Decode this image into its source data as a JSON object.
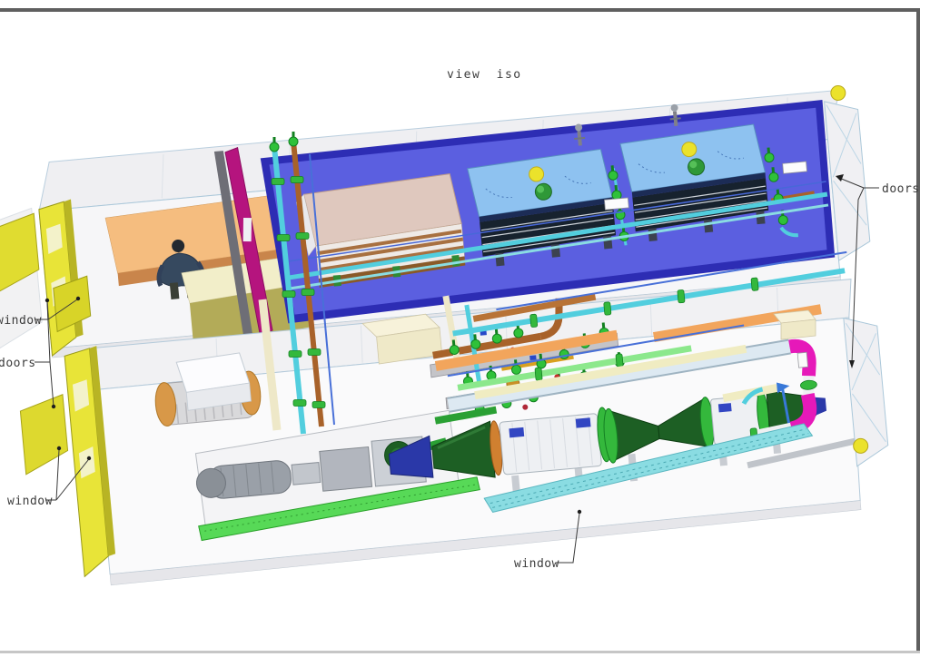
{
  "title": "view iso",
  "annotations": {
    "doors_right": "doors",
    "window_left_upper": "window",
    "doors_left": "doors",
    "window_left_lower": "window",
    "window_bottom": "window"
  },
  "colors": {
    "frame": "#5f5f5f",
    "frame_bottom": "#c6c6c6",
    "shell": "#efeff2",
    "shell_edge": "#a9c6d8",
    "floor_blue": "#5b5fe0",
    "floor_blue_rim": "#2d2db4",
    "cooler_blue": "#8ec2f0",
    "cooler_tan": "#dfc8be",
    "louver_dark": "#17222e",
    "door_yellow": "#e8e438",
    "partition_magenta": "#b5147e",
    "elbow_magenta": "#e619b9",
    "desk_orange": "#f5bd7f",
    "table_khaki": "#b3ab58",
    "valve_green": "#2fc13a",
    "baseplate_green": "#57d957",
    "walkway_cyan": "#8adce2",
    "pipe_copper": "#a8622a",
    "pipe_cyan": "#52cede",
    "pipe_pale": "#dde9f2",
    "pipe_orange": "#f2a55c",
    "cone_green": "#1d5f24",
    "sphere_yellow": "#ebe22b",
    "vessel_tan": "#d89848",
    "label_ink": "#3c3c3c"
  }
}
